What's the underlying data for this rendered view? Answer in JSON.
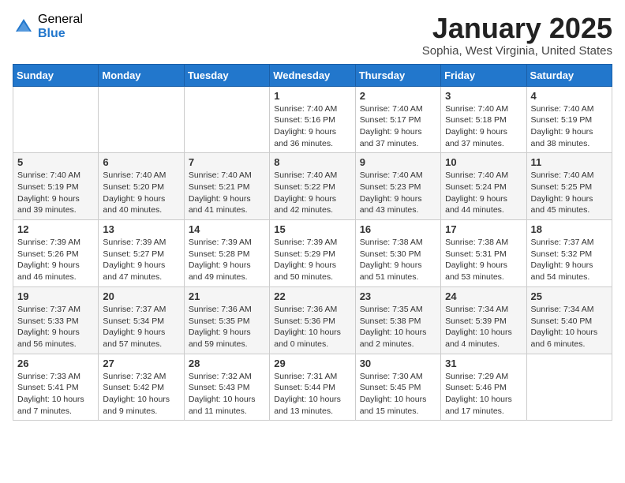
{
  "header": {
    "logo_general": "General",
    "logo_blue": "Blue",
    "month": "January 2025",
    "location": "Sophia, West Virginia, United States"
  },
  "weekdays": [
    "Sunday",
    "Monday",
    "Tuesday",
    "Wednesday",
    "Thursday",
    "Friday",
    "Saturday"
  ],
  "weeks": [
    [
      {
        "day": "",
        "info": ""
      },
      {
        "day": "",
        "info": ""
      },
      {
        "day": "",
        "info": ""
      },
      {
        "day": "1",
        "info": "Sunrise: 7:40 AM\nSunset: 5:16 PM\nDaylight: 9 hours and 36 minutes."
      },
      {
        "day": "2",
        "info": "Sunrise: 7:40 AM\nSunset: 5:17 PM\nDaylight: 9 hours and 37 minutes."
      },
      {
        "day": "3",
        "info": "Sunrise: 7:40 AM\nSunset: 5:18 PM\nDaylight: 9 hours and 37 minutes."
      },
      {
        "day": "4",
        "info": "Sunrise: 7:40 AM\nSunset: 5:19 PM\nDaylight: 9 hours and 38 minutes."
      }
    ],
    [
      {
        "day": "5",
        "info": "Sunrise: 7:40 AM\nSunset: 5:19 PM\nDaylight: 9 hours and 39 minutes."
      },
      {
        "day": "6",
        "info": "Sunrise: 7:40 AM\nSunset: 5:20 PM\nDaylight: 9 hours and 40 minutes."
      },
      {
        "day": "7",
        "info": "Sunrise: 7:40 AM\nSunset: 5:21 PM\nDaylight: 9 hours and 41 minutes."
      },
      {
        "day": "8",
        "info": "Sunrise: 7:40 AM\nSunset: 5:22 PM\nDaylight: 9 hours and 42 minutes."
      },
      {
        "day": "9",
        "info": "Sunrise: 7:40 AM\nSunset: 5:23 PM\nDaylight: 9 hours and 43 minutes."
      },
      {
        "day": "10",
        "info": "Sunrise: 7:40 AM\nSunset: 5:24 PM\nDaylight: 9 hours and 44 minutes."
      },
      {
        "day": "11",
        "info": "Sunrise: 7:40 AM\nSunset: 5:25 PM\nDaylight: 9 hours and 45 minutes."
      }
    ],
    [
      {
        "day": "12",
        "info": "Sunrise: 7:39 AM\nSunset: 5:26 PM\nDaylight: 9 hours and 46 minutes."
      },
      {
        "day": "13",
        "info": "Sunrise: 7:39 AM\nSunset: 5:27 PM\nDaylight: 9 hours and 47 minutes."
      },
      {
        "day": "14",
        "info": "Sunrise: 7:39 AM\nSunset: 5:28 PM\nDaylight: 9 hours and 49 minutes."
      },
      {
        "day": "15",
        "info": "Sunrise: 7:39 AM\nSunset: 5:29 PM\nDaylight: 9 hours and 50 minutes."
      },
      {
        "day": "16",
        "info": "Sunrise: 7:38 AM\nSunset: 5:30 PM\nDaylight: 9 hours and 51 minutes."
      },
      {
        "day": "17",
        "info": "Sunrise: 7:38 AM\nSunset: 5:31 PM\nDaylight: 9 hours and 53 minutes."
      },
      {
        "day": "18",
        "info": "Sunrise: 7:37 AM\nSunset: 5:32 PM\nDaylight: 9 hours and 54 minutes."
      }
    ],
    [
      {
        "day": "19",
        "info": "Sunrise: 7:37 AM\nSunset: 5:33 PM\nDaylight: 9 hours and 56 minutes."
      },
      {
        "day": "20",
        "info": "Sunrise: 7:37 AM\nSunset: 5:34 PM\nDaylight: 9 hours and 57 minutes."
      },
      {
        "day": "21",
        "info": "Sunrise: 7:36 AM\nSunset: 5:35 PM\nDaylight: 9 hours and 59 minutes."
      },
      {
        "day": "22",
        "info": "Sunrise: 7:36 AM\nSunset: 5:36 PM\nDaylight: 10 hours and 0 minutes."
      },
      {
        "day": "23",
        "info": "Sunrise: 7:35 AM\nSunset: 5:38 PM\nDaylight: 10 hours and 2 minutes."
      },
      {
        "day": "24",
        "info": "Sunrise: 7:34 AM\nSunset: 5:39 PM\nDaylight: 10 hours and 4 minutes."
      },
      {
        "day": "25",
        "info": "Sunrise: 7:34 AM\nSunset: 5:40 PM\nDaylight: 10 hours and 6 minutes."
      }
    ],
    [
      {
        "day": "26",
        "info": "Sunrise: 7:33 AM\nSunset: 5:41 PM\nDaylight: 10 hours and 7 minutes."
      },
      {
        "day": "27",
        "info": "Sunrise: 7:32 AM\nSunset: 5:42 PM\nDaylight: 10 hours and 9 minutes."
      },
      {
        "day": "28",
        "info": "Sunrise: 7:32 AM\nSunset: 5:43 PM\nDaylight: 10 hours and 11 minutes."
      },
      {
        "day": "29",
        "info": "Sunrise: 7:31 AM\nSunset: 5:44 PM\nDaylight: 10 hours and 13 minutes."
      },
      {
        "day": "30",
        "info": "Sunrise: 7:30 AM\nSunset: 5:45 PM\nDaylight: 10 hours and 15 minutes."
      },
      {
        "day": "31",
        "info": "Sunrise: 7:29 AM\nSunset: 5:46 PM\nDaylight: 10 hours and 17 minutes."
      },
      {
        "day": "",
        "info": ""
      }
    ]
  ]
}
